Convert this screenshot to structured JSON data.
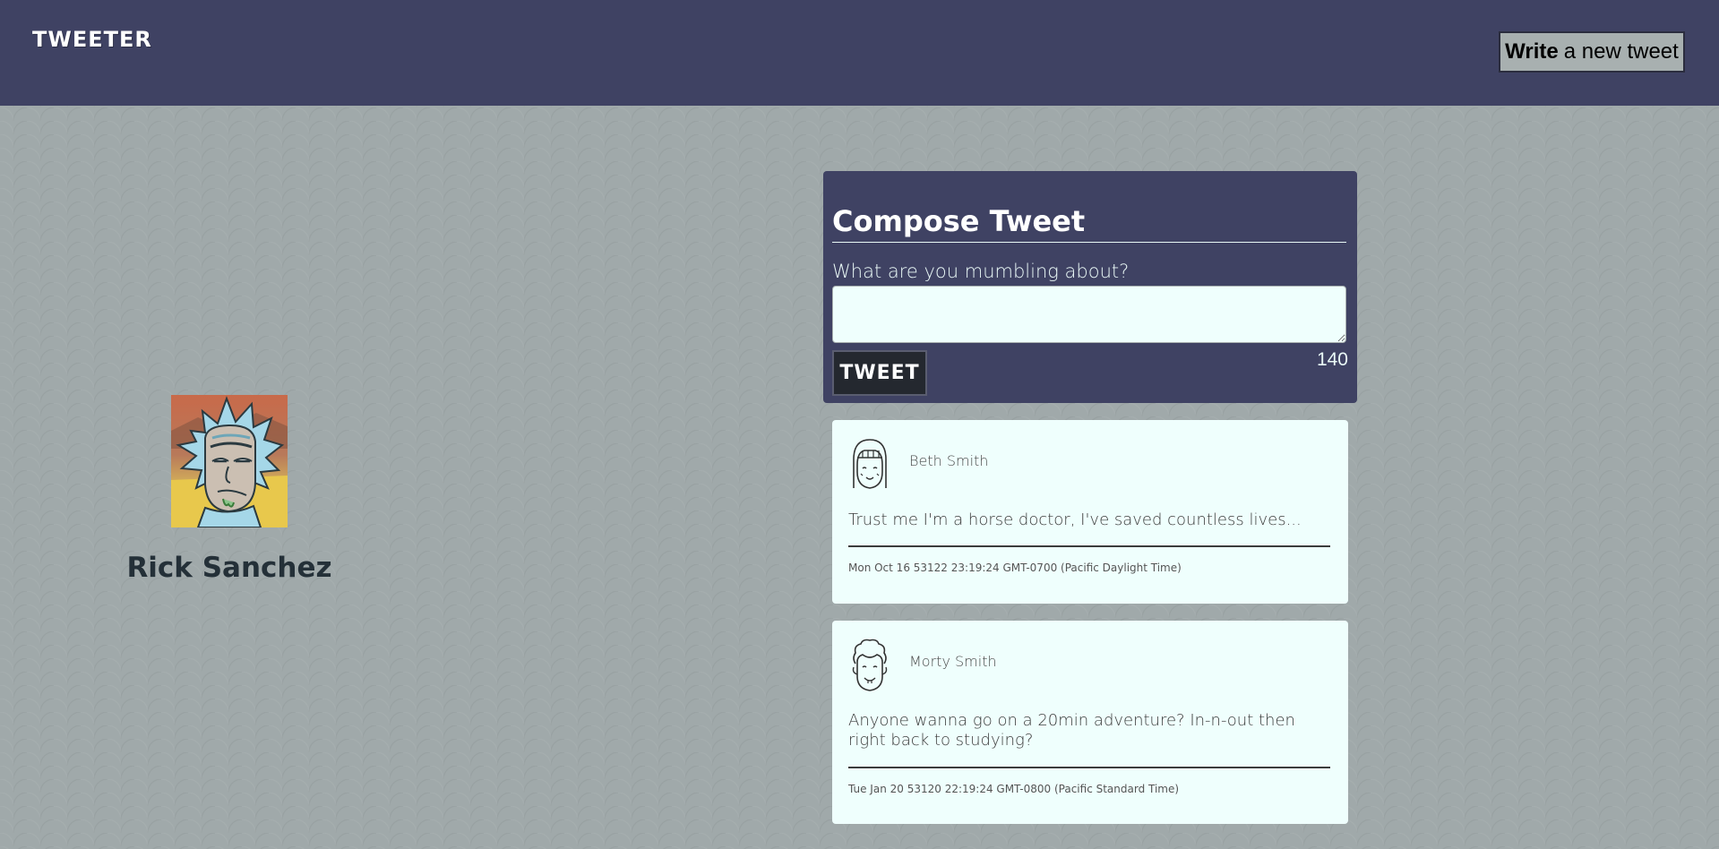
{
  "nav": {
    "brand": "TWEETER",
    "write_bold": "Write",
    "write_rest": "a new tweet"
  },
  "profile": {
    "name": "Rick Sanchez",
    "avatar_icon": "rick-avatar-icon"
  },
  "compose": {
    "title": "Compose Tweet",
    "label": "What are you mumbling about?",
    "textarea_value": "",
    "button_label": "TWEET",
    "counter": "140"
  },
  "tweets": [
    {
      "name": "Beth Smith",
      "avatar_icon": "female-avatar-icon",
      "content": "Trust me I'm a horse doctor, I've saved countless lives...",
      "timestamp": "Mon Oct 16 53122 23:19:24 GMT-0700 (Pacific Daylight Time)"
    },
    {
      "name": "Morty Smith",
      "avatar_icon": "male-avatar-icon",
      "content": "Anyone wanna go on a 20min adventure? In-n-out then right back to studying?",
      "timestamp": "Tue Jan 20 53120 22:19:24 GMT-0800 (Pacific Standard Time)"
    }
  ],
  "colors": {
    "nav_bg": "#3f4263",
    "page_bg": "#a0a9aa",
    "card_bg": "#effffd",
    "tweet_button_bg": "#24282f"
  }
}
